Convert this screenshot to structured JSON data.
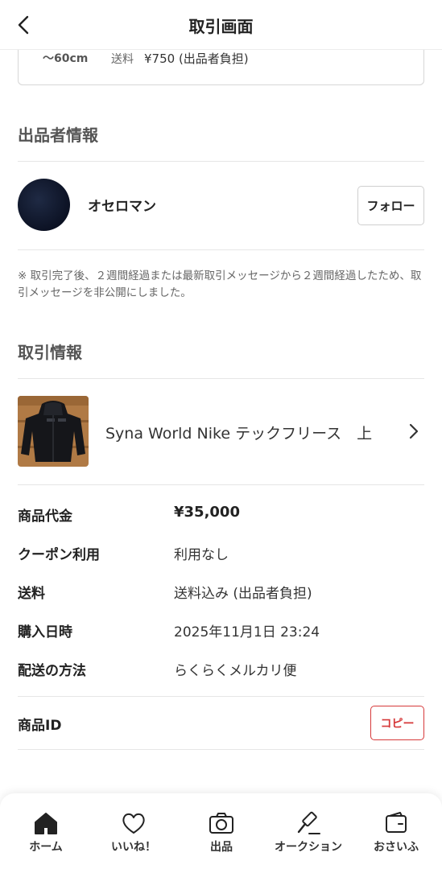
{
  "header": {
    "title": "取引画面"
  },
  "shipping": {
    "size": "〜60cm",
    "fee_label": "送料",
    "fee_value": "¥750 (出品者負担)"
  },
  "seller_section": {
    "title": "出品者情報",
    "name": "オセロマン",
    "follow_label": "フォロー"
  },
  "notice": "※ 取引完了後、２週間経過または最新取引メッセージから２週間経過したため、取引メッセージを非公開にしました。",
  "trade_section": {
    "title": "取引情報",
    "product_title": "Syna World Nike テックフリース　上"
  },
  "trade_info": [
    {
      "label": "商品代金",
      "value": "¥35,000"
    },
    {
      "label": "クーポン利用",
      "value": "利用なし"
    },
    {
      "label": "送料",
      "value": "送料込み (出品者負担)"
    },
    {
      "label": "購入日時",
      "value": "2025年11月1日 23:24"
    },
    {
      "label": "配送の方法",
      "value": "らくらくメルカリ便"
    }
  ],
  "product_id": {
    "label": "商品ID",
    "copy_label": "コピー"
  },
  "bottom_nav": [
    {
      "label": "ホーム",
      "icon": "home-icon"
    },
    {
      "label": "いいね！",
      "icon": "heart-icon"
    },
    {
      "label": "出品",
      "icon": "camera-icon"
    },
    {
      "label": "オークション",
      "icon": "gavel-icon"
    },
    {
      "label": "おさいふ",
      "icon": "wallet-icon"
    }
  ],
  "colors": {
    "accent_red": "#d6393a",
    "text": "#222222",
    "muted": "#666666"
  }
}
